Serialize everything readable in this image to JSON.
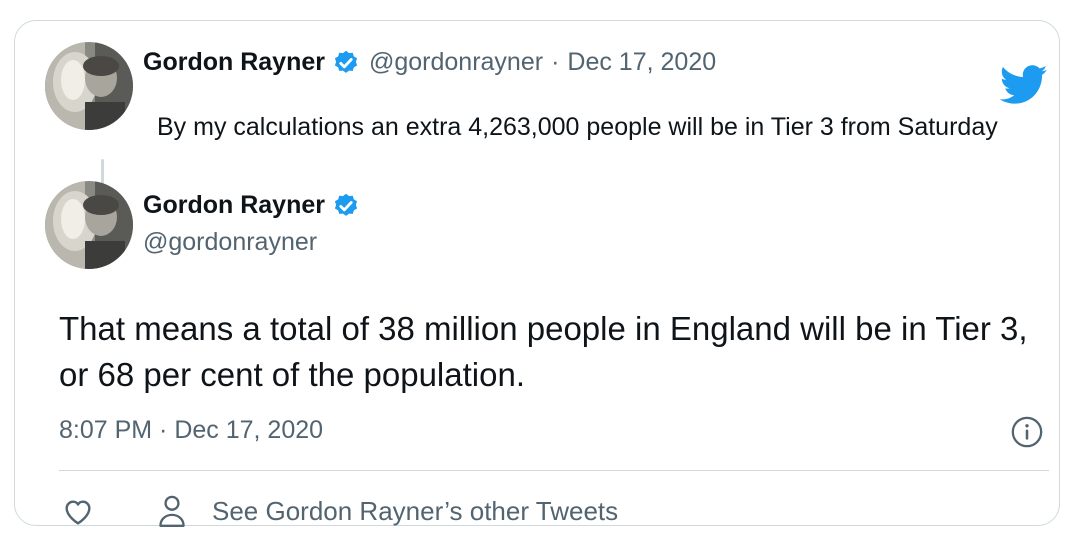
{
  "reply_tweet": {
    "author_name": "Gordon Rayner",
    "handle": "@gordonrayner",
    "separator": "·",
    "date": "Dec 17, 2020",
    "text": "By my calculations an extra 4,263,000 people will be in Tier 3 from Saturday"
  },
  "main_tweet": {
    "author_name": "Gordon Rayner",
    "handle": "@gordonrayner",
    "text": "That means a total of 38 million people in England will be in Tier 3, or 68 per cent of the population.",
    "timestamp": "8:07 PM · Dec 17, 2020"
  },
  "actions": {
    "other_tweets_label": "See Gordon Rayner’s other Tweets"
  },
  "icons": {
    "logo": "twitter-bird-icon",
    "verified": "verified-badge-icon",
    "info": "info-icon",
    "like": "heart-icon",
    "profile": "person-icon"
  },
  "colors": {
    "brand_blue": "#1d9bf0",
    "text_primary": "#0f1419",
    "text_secondary": "#536471",
    "border": "#cfd9de"
  }
}
